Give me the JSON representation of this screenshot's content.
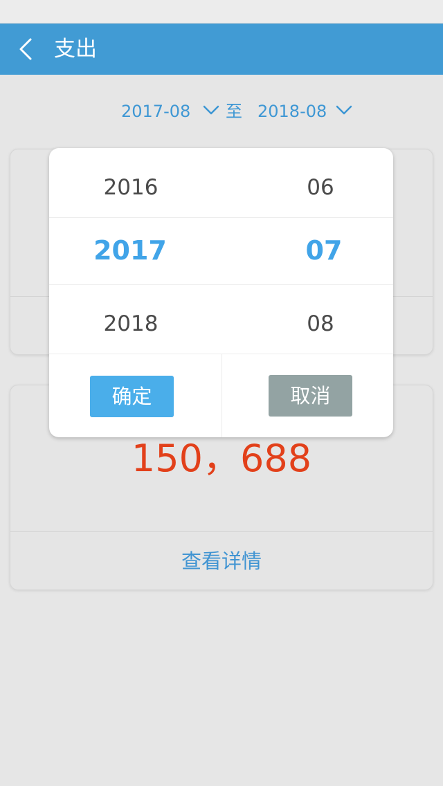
{
  "header": {
    "title": "支出"
  },
  "date_range": {
    "start": "2017-08",
    "separator": "至",
    "end": "2018-08"
  },
  "summary": {
    "amount": "150，688",
    "detail_link": "查看详情"
  },
  "picker": {
    "years": [
      "2016",
      "2017",
      "2018"
    ],
    "months": [
      "06",
      "07",
      "08"
    ],
    "selected_year": "2017",
    "selected_month": "07",
    "confirm_label": "确定",
    "cancel_label": "取消"
  },
  "colors": {
    "header_bg": "#419bd4",
    "accent_blue": "#41a4e8",
    "amount_red": "#e2401a",
    "confirm_bg": "#4aaeea",
    "cancel_bg": "#93a3a3"
  }
}
